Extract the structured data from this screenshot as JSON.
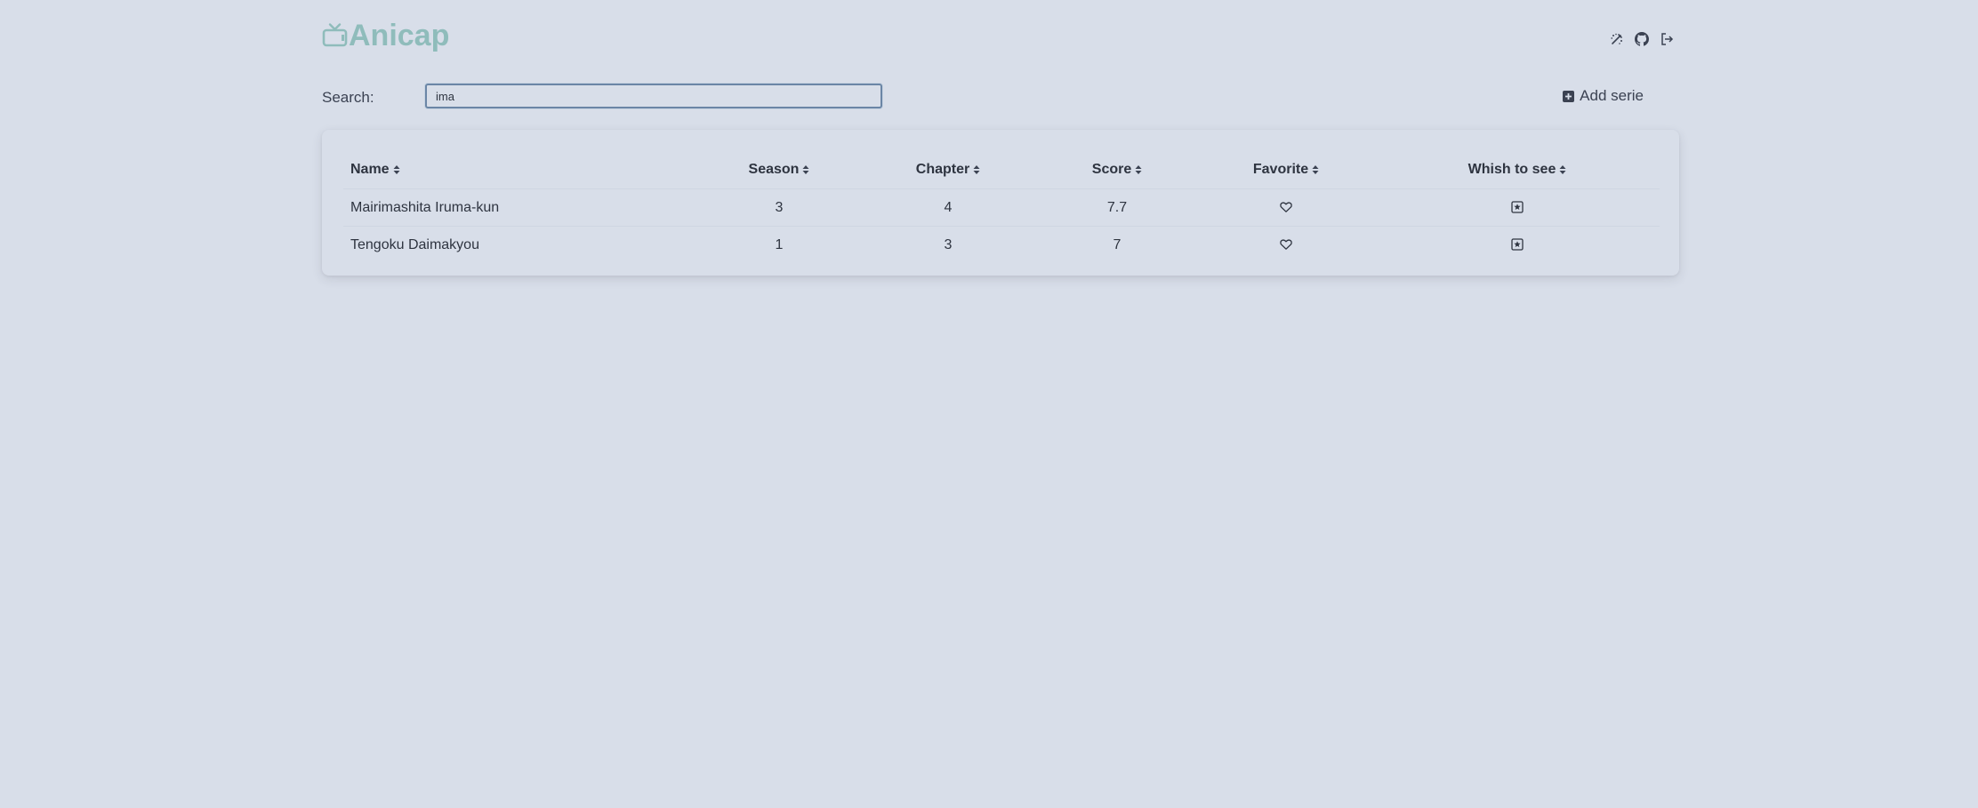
{
  "app": {
    "title": "Anicap",
    "logo_icon": "tv-icon",
    "brand_color": "#8fbcbb"
  },
  "header": {
    "icons": [
      {
        "name": "theme-toggle-icon"
      },
      {
        "name": "github-icon"
      },
      {
        "name": "logout-icon"
      }
    ]
  },
  "search": {
    "label": "Search:",
    "value": "ima",
    "placeholder": ""
  },
  "actions": {
    "add_label": "Add serie",
    "add_icon": "plus-square-icon"
  },
  "table": {
    "columns": [
      "Name",
      "Season",
      "Chapter",
      "Score",
      "Favorite",
      "Whish to see"
    ],
    "rows": [
      {
        "name": "Mairimashita Iruma-kun",
        "season": "3",
        "chapter": "4",
        "score": "7.7",
        "favorite": "heart-outline-icon",
        "wish": "star-square-icon"
      },
      {
        "name": "Tengoku Daimakyou",
        "season": "1",
        "chapter": "3",
        "score": "7",
        "favorite": "heart-outline-icon",
        "wish": "star-square-icon"
      }
    ]
  },
  "colors": {
    "background": "#d8dee9",
    "text": "#2e3440",
    "input_border": "#6b86a6"
  }
}
